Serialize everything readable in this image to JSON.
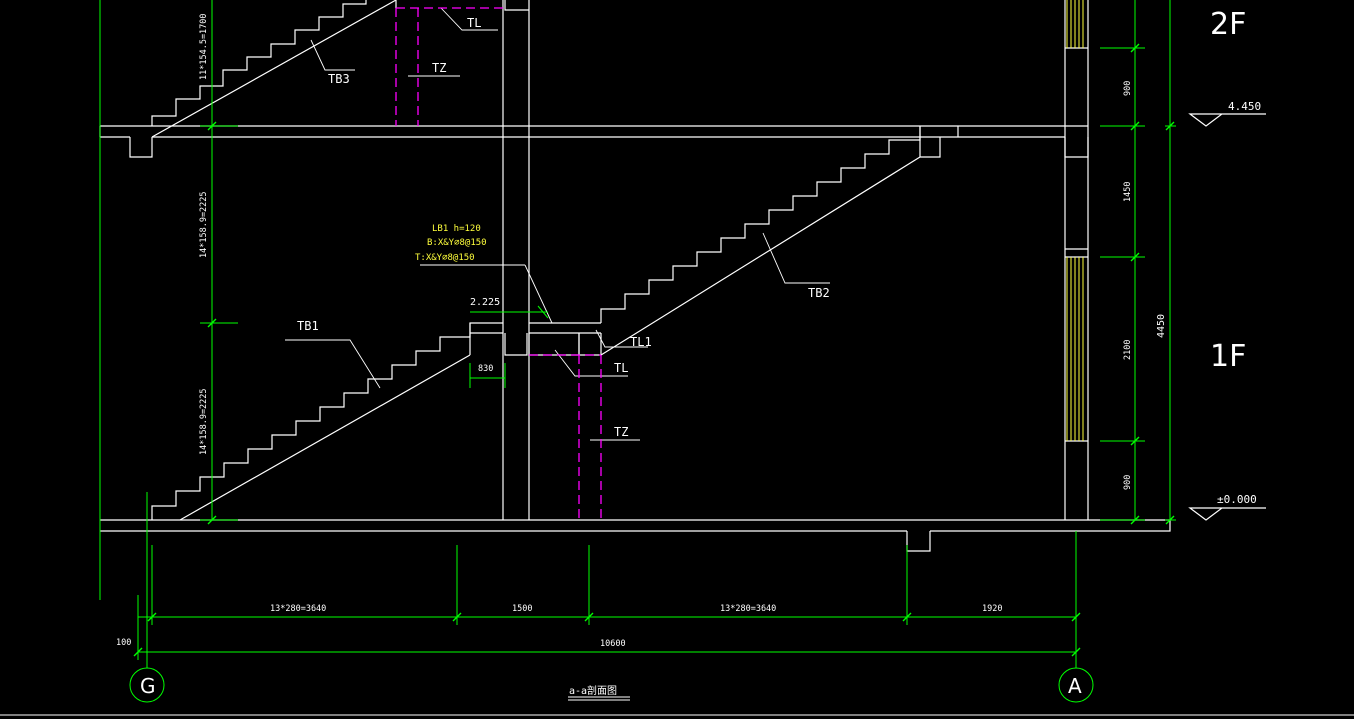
{
  "colors": {
    "background": "#000000",
    "structure": "#ffffff",
    "dimension": "#00ff00",
    "column": "#ff00ff",
    "note": "#ffff3c",
    "window": "#ffff3c"
  },
  "floors": {
    "upper": "2F",
    "lower": "1F"
  },
  "elevations": {
    "upper": "4.450",
    "ground": "±0.000"
  },
  "members": {
    "tb1": "TB1",
    "tb2": "TB2",
    "tb3": "TB3",
    "tl_top": "TL",
    "tl_mid": "TL",
    "tl1": "TL1",
    "tz_top": "TZ",
    "tz_mid": "TZ"
  },
  "landing_note": {
    "line1": "LB1  h=120",
    "line2": "B:X&Y⌀8@150",
    "line3": "T:X&Y⌀8@150"
  },
  "landing_elevation": "2.225",
  "landing_width": "830",
  "vertical_dims": {
    "stair_upper": "11*154.5=1700",
    "stair_mid": "14*158.9=2225",
    "stair_low": "14*158.9=2225",
    "right_900_top": "900",
    "right_1450": "1450",
    "right_2100": "2100",
    "right_900_bottom": "900",
    "total": "4450"
  },
  "horizontal_dims": {
    "flight1": "13*280=3640",
    "landing": "1500",
    "flight2": "13*280=3640",
    "end": "1920",
    "total": "10600",
    "offset": "100"
  },
  "grid_axes": {
    "left": "G",
    "right": "A"
  },
  "section_title": "a-a剖面图"
}
